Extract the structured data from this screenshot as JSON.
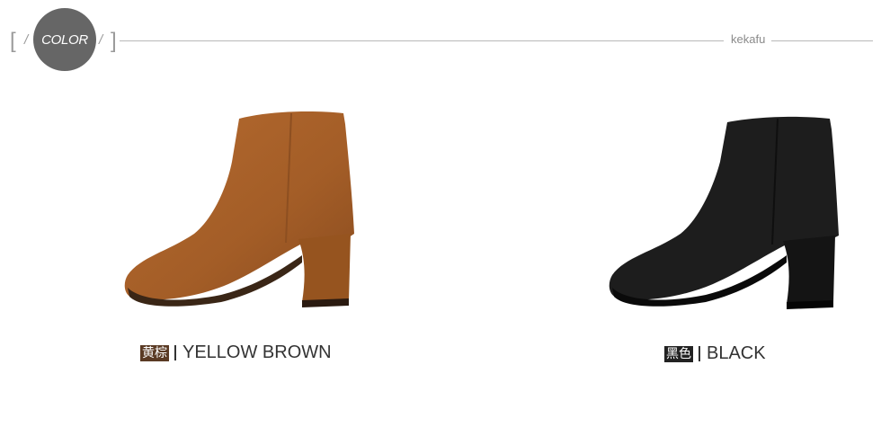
{
  "header": {
    "section_label": "COLOR",
    "left_bracket": "[",
    "right_bracket": "]",
    "slash_left": "/",
    "slash_right": "/",
    "brand": "kekafu"
  },
  "products": [
    {
      "color_tag_cn": "黄棕",
      "color_name": "YELLOW BROWN",
      "tag_color": "#5a3a24",
      "boot_color": "#a8622c",
      "image_icon": "ankle-boot-icon"
    },
    {
      "color_tag_cn": "黑色",
      "color_name": "BLACK",
      "tag_color": "#222222",
      "boot_color": "#1c1c1c",
      "image_icon": "ankle-boot-icon"
    }
  ],
  "colors": {
    "circle": "#666666",
    "rule": "#b8b8b8",
    "text": "#333333"
  }
}
